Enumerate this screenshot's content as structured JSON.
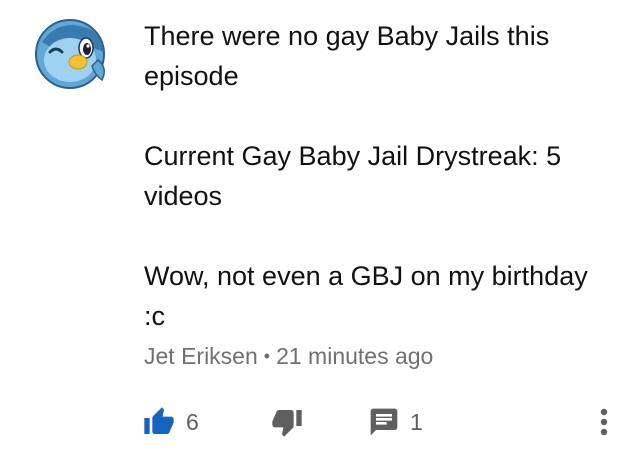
{
  "comment": {
    "avatar_icon": "piplup-avatar-icon",
    "paragraphs": [
      "There were no gay Baby Jails this episode",
      "Current Gay Baby Jail Drystreak: 5 videos",
      "Wow, not even a GBJ on my birthday :c"
    ],
    "author": "Jet Eriksen",
    "separator": "•",
    "timestamp": "21 minutes ago"
  },
  "actions": {
    "like_icon": "thumbs-up-icon",
    "like_count": "6",
    "dislike_icon": "thumbs-down-icon",
    "reply_icon": "comment-icon",
    "reply_count": "1",
    "more_icon": "more-vertical-icon"
  },
  "colors": {
    "like_active": "#1565c0",
    "icon_gray": "#5f5f5f",
    "text_primary": "#111111",
    "text_secondary": "#707070",
    "avatar_blue": "#5fa8d8",
    "avatar_dark": "#2f5f8c",
    "avatar_beak": "#f2c230"
  }
}
